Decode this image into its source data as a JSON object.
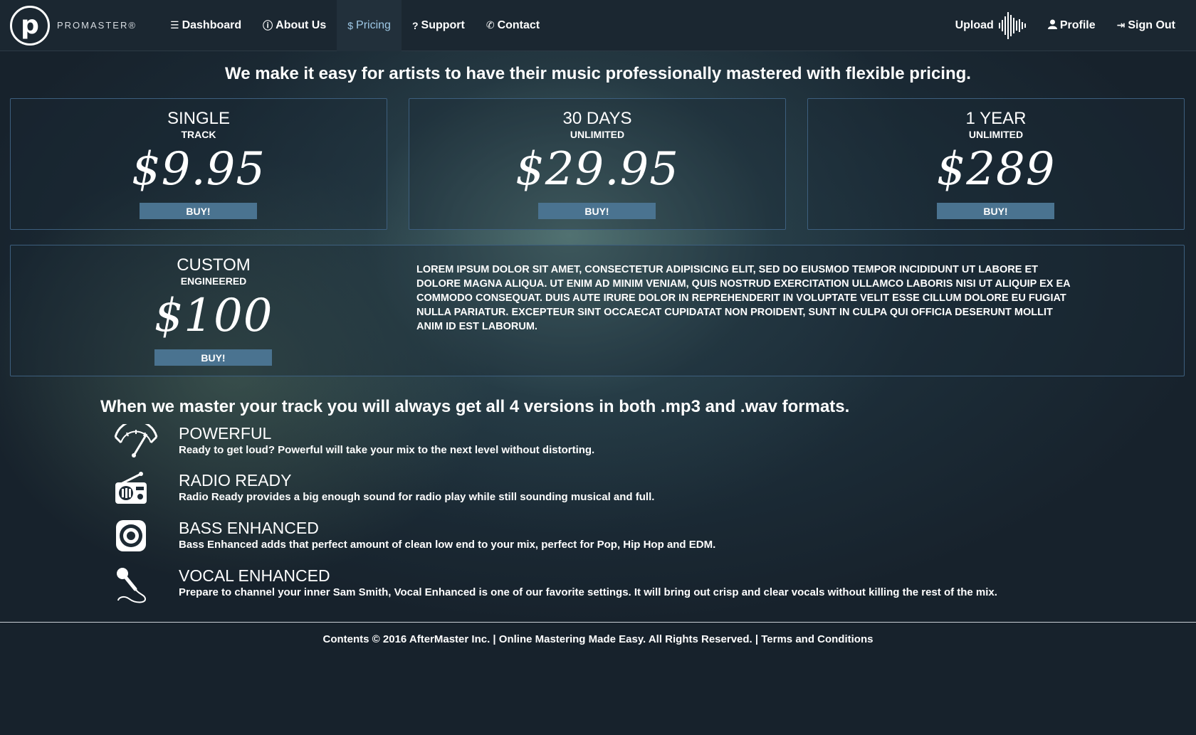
{
  "brand": {
    "logo_letter": "p",
    "name": "PROMASTER®"
  },
  "nav": {
    "items": [
      {
        "label": "Dashboard",
        "icon": "sliders-icon",
        "glyph": "☰"
      },
      {
        "label": "About Us",
        "icon": "info-circle-icon",
        "glyph": "ⓘ"
      },
      {
        "label": "Pricing",
        "icon": "dollar-icon",
        "glyph": "$",
        "active": true
      },
      {
        "label": "Support",
        "icon": "question-circle-icon",
        "glyph": "?"
      },
      {
        "label": "Contact",
        "icon": "phone-icon",
        "glyph": "✆"
      }
    ],
    "right": [
      {
        "label": "Upload",
        "icon": "waveform-icon"
      },
      {
        "label": "Profile",
        "icon": "user-icon",
        "glyph": "👤"
      },
      {
        "label": "Sign Out",
        "icon": "sign-out-icon",
        "glyph": "⇥"
      }
    ]
  },
  "headline": "We make it easy for artists to have their music professionally mastered with flexible pricing.",
  "plans": [
    {
      "name": "SINGLE",
      "sub": "TRACK",
      "price": "$9.95",
      "buy": "BUY!"
    },
    {
      "name": "30 DAYS",
      "sub": "UNLIMITED",
      "price": "$29.95",
      "buy": "BUY!"
    },
    {
      "name": "1 YEAR",
      "sub": "UNLIMITED",
      "price": "$289",
      "buy": "BUY!"
    }
  ],
  "custom": {
    "name": "CUSTOM",
    "sub": "ENGINEERED",
    "price": "$100",
    "buy": "BUY!",
    "description": "Lorem ipsum dolor sit amet, consectetur adipisicing elit, sed do eiusmod tempor incididunt ut labore et dolore magna aliqua. Ut enim ad minim veniam, quis nostrud exercitation ullamco laboris nisi ut aliquip ex ea commodo consequat. Duis aute irure dolor in reprehenderit in voluptate velit esse cillum dolore eu fugiat nulla pariatur. Excepteur sint occaecat cupidatat non proident, sunt in culpa qui officia deserunt mollit anim id est laborum."
  },
  "features": {
    "title": "When we master your track you will always get all 4 versions in both .mp3 and .wav formats.",
    "items": [
      {
        "title": "Powerful",
        "desc": "Ready to get loud? Powerful will take your mix to the next level without distorting.",
        "icon": "gauge-icon"
      },
      {
        "title": "Radio Ready",
        "desc": "Radio Ready provides a big enough sound for radio play while still sounding musical and full.",
        "icon": "radio-icon"
      },
      {
        "title": "Bass Enhanced",
        "desc": "Bass Enhanced adds that perfect amount of clean low end to your mix, perfect for Pop, Hip Hop and EDM.",
        "icon": "speaker-icon"
      },
      {
        "title": "Vocal Enhanced",
        "desc": "Prepare to channel your inner Sam Smith, Vocal Enhanced is one of our favorite settings. It will bring out crisp and clear vocals without killing the rest of the mix.",
        "icon": "microphone-icon"
      }
    ]
  },
  "footer": "Contents © 2016 AfterMaster Inc. | Online Mastering Made Easy. All Rights Reserved. | Terms and Conditions"
}
